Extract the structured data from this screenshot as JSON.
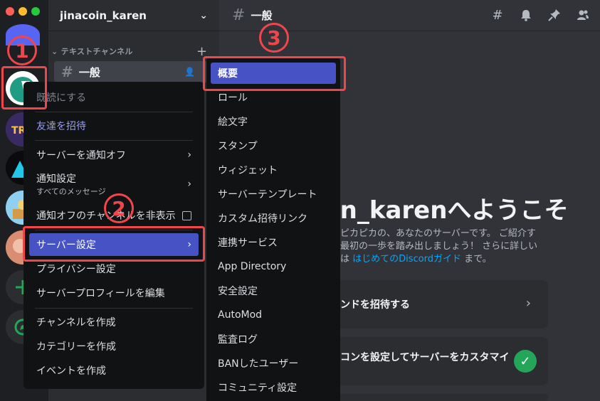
{
  "server": {
    "name": "jinacoin_karen"
  },
  "sidebar": {
    "category": "テキストチャンネル",
    "channel": "一般"
  },
  "main": {
    "channel_title": "一般",
    "welcome_title": "in_karenへようこそ",
    "welcome_line1": "ピカピカの、あなたのサーバーです。 ご紹介す",
    "welcome_line2": "最初の一歩を踏み出しましょう！ さらに詳しい",
    "welcome_line3_prefix": "は ",
    "welcome_line3_link": "はじめてのDiscordガイド",
    "welcome_line3_suffix": " まで。",
    "card1": "ンドを招待する",
    "card2": "コンを設定してサーバーをカスタマイ"
  },
  "context_menu": {
    "mark_read": "既読にする",
    "invite": "友達を招待",
    "mute_server": "サーバーを通知オフ",
    "notify_settings": "通知設定",
    "notify_sub": "すべてのメッセージ",
    "hide_muted": "通知オフのチャンネルを非表示",
    "server_settings": "サーバー設定",
    "privacy": "プライバシー設定",
    "edit_profile": "サーバープロフィールを編集",
    "create_channel": "チャンネルを作成",
    "create_category": "カテゴリーを作成",
    "create_event": "イベントを作成"
  },
  "submenu": {
    "items": [
      "概要",
      "ロール",
      "絵文字",
      "スタンプ",
      "ウィジェット",
      "サーバーテンプレート",
      "カスタム招待リンク",
      "連携サービス",
      "App Directory",
      "安全設定",
      "AutoMod",
      "監査ログ",
      "BANしたユーザー",
      "コミュニティ設定"
    ]
  },
  "annotations": {
    "n1": "1",
    "n2": "2",
    "n3": "3"
  },
  "colors": {
    "accent": "#4752c4",
    "callout": "#f0454a",
    "link": "#00a8fc",
    "success": "#23a55a"
  }
}
